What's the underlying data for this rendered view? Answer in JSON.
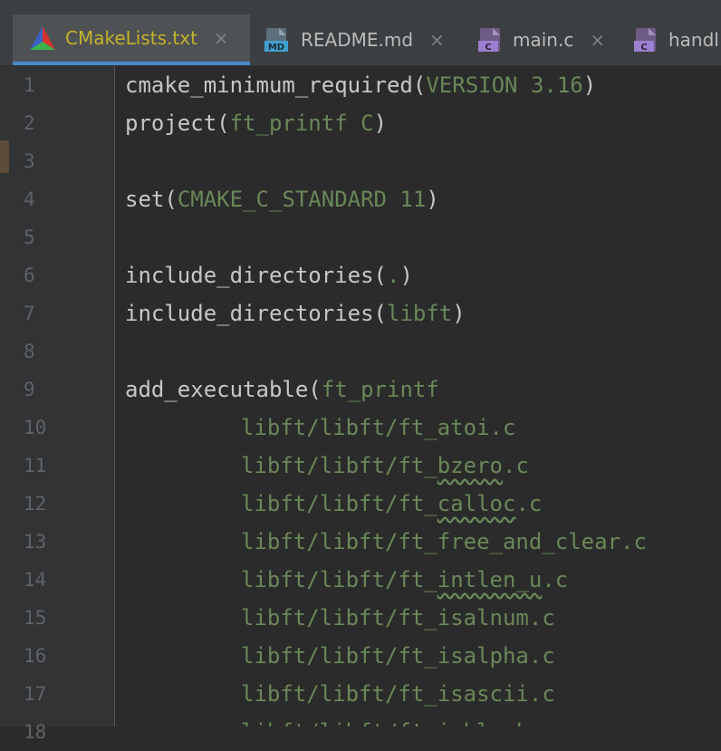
{
  "tabs": [
    {
      "label": "CMakeLists.txt",
      "icon": "cmake-icon",
      "active": true
    },
    {
      "label": "README.md",
      "icon": "markdown-file-icon",
      "icon_text": "MD",
      "active": false
    },
    {
      "label": "main.c",
      "icon": "c-file-icon",
      "icon_text": "C",
      "active": false
    },
    {
      "label": "handl",
      "icon": "c-file-icon",
      "icon_text": "C",
      "active": false
    }
  ],
  "close_glyph": "×",
  "lines": [
    {
      "num": "1",
      "fn": "cmake_minimum_required",
      "open": "(",
      "arg": "VERSION 3.16",
      "close": ")"
    },
    {
      "num": "2",
      "fn": "project",
      "open": "(",
      "arg": "ft_printf C",
      "close": ")"
    },
    {
      "num": "3",
      "fn": "",
      "open": "",
      "arg": "",
      "close": ""
    },
    {
      "num": "4",
      "fn": "set",
      "open": "(",
      "arg": "CMAKE_C_STANDARD 11",
      "close": ")"
    },
    {
      "num": "5",
      "fn": "",
      "open": "",
      "arg": "",
      "close": ""
    },
    {
      "num": "6",
      "fn": "include_directories",
      "open": "(",
      "arg": ".",
      "close": ")"
    },
    {
      "num": "7",
      "fn": "include_directories",
      "open": "(",
      "arg": "libft",
      "close": ")"
    },
    {
      "num": "8",
      "fn": "",
      "open": "",
      "arg": "",
      "close": ""
    },
    {
      "num": "9",
      "fn": "add_executable",
      "open": "(",
      "arg": "ft_printf",
      "close": ""
    },
    {
      "num": "10",
      "indent": true,
      "pre": "libft/libft/ft_atoi.c",
      "sq": "",
      "post": ""
    },
    {
      "num": "11",
      "indent": true,
      "pre": "libft/libft/ft_",
      "sq": "bzero",
      "post": ".c"
    },
    {
      "num": "12",
      "indent": true,
      "pre": "libft/libft/ft_",
      "sq": "calloc",
      "post": ".c"
    },
    {
      "num": "13",
      "indent": true,
      "pre": "libft/libft/ft_free_and_clear.c",
      "sq": "",
      "post": ""
    },
    {
      "num": "14",
      "indent": true,
      "pre": "libft/libft/ft_",
      "sq": "intlen_u",
      "post": ".c"
    },
    {
      "num": "15",
      "indent": true,
      "pre": "libft/libft/ft_isalnum.c",
      "sq": "",
      "post": ""
    },
    {
      "num": "16",
      "indent": true,
      "pre": "libft/libft/ft_isalpha.c",
      "sq": "",
      "post": ""
    },
    {
      "num": "17",
      "indent": true,
      "pre": "libft/libft/ft_isascii.c",
      "sq": "",
      "post": ""
    },
    {
      "num": "18",
      "indent": true,
      "pre": "libft/libft/ft_isblank.c",
      "sq": "",
      "post": ""
    }
  ],
  "colors": {
    "background": "#2b2b2b",
    "gutter": "#313335",
    "active_tab_label": "#c4b22b",
    "function": "#c5c8c6",
    "argument": "#6a8759",
    "line_number": "#606366"
  }
}
